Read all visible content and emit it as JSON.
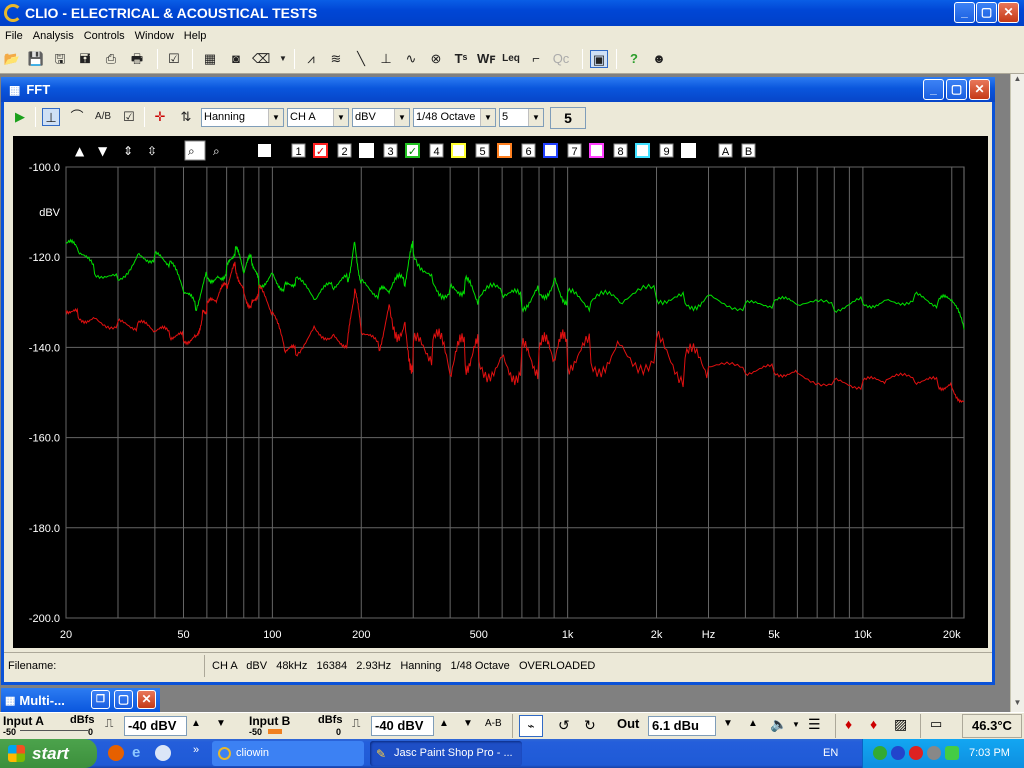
{
  "app": {
    "title": "CLIO - ELECTRICAL & ACOUSTICAL TESTS",
    "controls": {
      "min": "_",
      "max": "▢",
      "close": "✕"
    }
  },
  "menu": [
    "File",
    "Analysis",
    "Controls",
    "Window",
    "Help"
  ],
  "fft_window": {
    "title": "FFT",
    "window_type": "Hanning",
    "channel": "CH A",
    "unit": "dBV",
    "smoothing": "1/48 Octave",
    "averages": "5",
    "average_count": "5",
    "curve_labels": [
      "1",
      "2",
      "3",
      "4",
      "5",
      "6",
      "7",
      "8",
      "9"
    ],
    "ab_labels": [
      "A",
      "B"
    ],
    "status": {
      "filename_label": "Filename:",
      "info": "CH A   dBV   48kHz   16384   2.93Hz   Hanning   1/48 Octave   OVERLOADED"
    }
  },
  "chart_data": {
    "type": "line",
    "title": "",
    "xlabel": "Hz",
    "ylabel": "dBV",
    "xscale": "log",
    "xlim": [
      20,
      22000
    ],
    "ylim": [
      -200,
      -100
    ],
    "x_ticks": [
      "20",
      "50",
      "100",
      "200",
      "500",
      "1k",
      "2k",
      "Hz",
      "5k",
      "10k",
      "20k"
    ],
    "y_ticks": [
      "-100.0",
      "-120.0",
      "-140.0",
      "-160.0",
      "-180.0",
      "-200.0"
    ],
    "grid": true,
    "series": [
      {
        "color": "#00e000",
        "x": [
          20,
          22,
          25,
          30,
          35,
          40,
          45,
          50,
          55,
          60,
          65,
          70,
          75,
          80,
          85,
          90,
          100,
          110,
          120,
          140,
          160,
          180,
          190,
          200,
          230,
          250,
          280,
          300,
          350,
          400,
          450,
          500,
          600,
          700,
          800,
          900,
          1000,
          1200,
          1500,
          2000,
          2500,
          3000,
          4000,
          5000,
          6000,
          8000,
          10000,
          12000,
          15000,
          18000,
          20000,
          22000
        ],
        "y": [
          -117,
          -118,
          -123,
          -125,
          -120,
          -120,
          -121,
          -127,
          -131,
          -124,
          -125,
          -123,
          -118,
          -123,
          -120,
          -126,
          -124,
          -127,
          -125,
          -129,
          -126,
          -125,
          -117,
          -126,
          -128,
          -127,
          -125,
          -118,
          -126,
          -128,
          -126,
          -129,
          -127,
          -130,
          -128,
          -126,
          -129,
          -130,
          -129,
          -128,
          -130,
          -129,
          -131,
          -130,
          -130,
          -131,
          -130,
          -130,
          -129,
          -130,
          -129,
          -136
        ]
      },
      {
        "color": "#e01010",
        "x": [
          20,
          22,
          25,
          30,
          35,
          40,
          45,
          50,
          55,
          58,
          60,
          65,
          70,
          75,
          80,
          85,
          90,
          100,
          110,
          120,
          140,
          160,
          180,
          190,
          200,
          230,
          250,
          280,
          300,
          350,
          400,
          450,
          500,
          600,
          700,
          800,
          900,
          1000,
          1200,
          1500,
          2000,
          2500,
          3000,
          4000,
          5000,
          6000,
          8000,
          10000,
          12000,
          15000,
          18000,
          20000,
          22000
        ],
        "y": [
          -131,
          -133,
          -134,
          -135,
          -135,
          -136,
          -137,
          -138,
          -138,
          -133,
          -131,
          -129,
          -126,
          -122,
          -128,
          -131,
          -127,
          -132,
          -140,
          -141,
          -136,
          -138,
          -139,
          -127,
          -136,
          -140,
          -131,
          -137,
          -142,
          -139,
          -144,
          -141,
          -142,
          -144,
          -143,
          -142,
          -141,
          -141,
          -142,
          -141,
          -141,
          -144,
          -144,
          -145,
          -145,
          -146,
          -148,
          -148,
          -147,
          -147,
          -148,
          -149,
          -152
        ]
      }
    ]
  },
  "bottom": {
    "input_a_label": "Input A",
    "input_b_label": "Input B",
    "dbfs": "dBfs",
    "scale_min": "-50",
    "scale_max": "0",
    "input_a_value": "-40 dBV",
    "input_b_value": "-40 dBV",
    "out_label": "Out",
    "out_value": "6.1 dBu",
    "temp": "46.3°C",
    "ab": "A-B"
  },
  "minimized": {
    "title": "Multi-..."
  },
  "taskbar": {
    "start": "start",
    "tasks": [
      "cliowin",
      "Jasc Paint Shop Pro - ..."
    ],
    "lang": "EN",
    "clock": "7:03 PM"
  }
}
